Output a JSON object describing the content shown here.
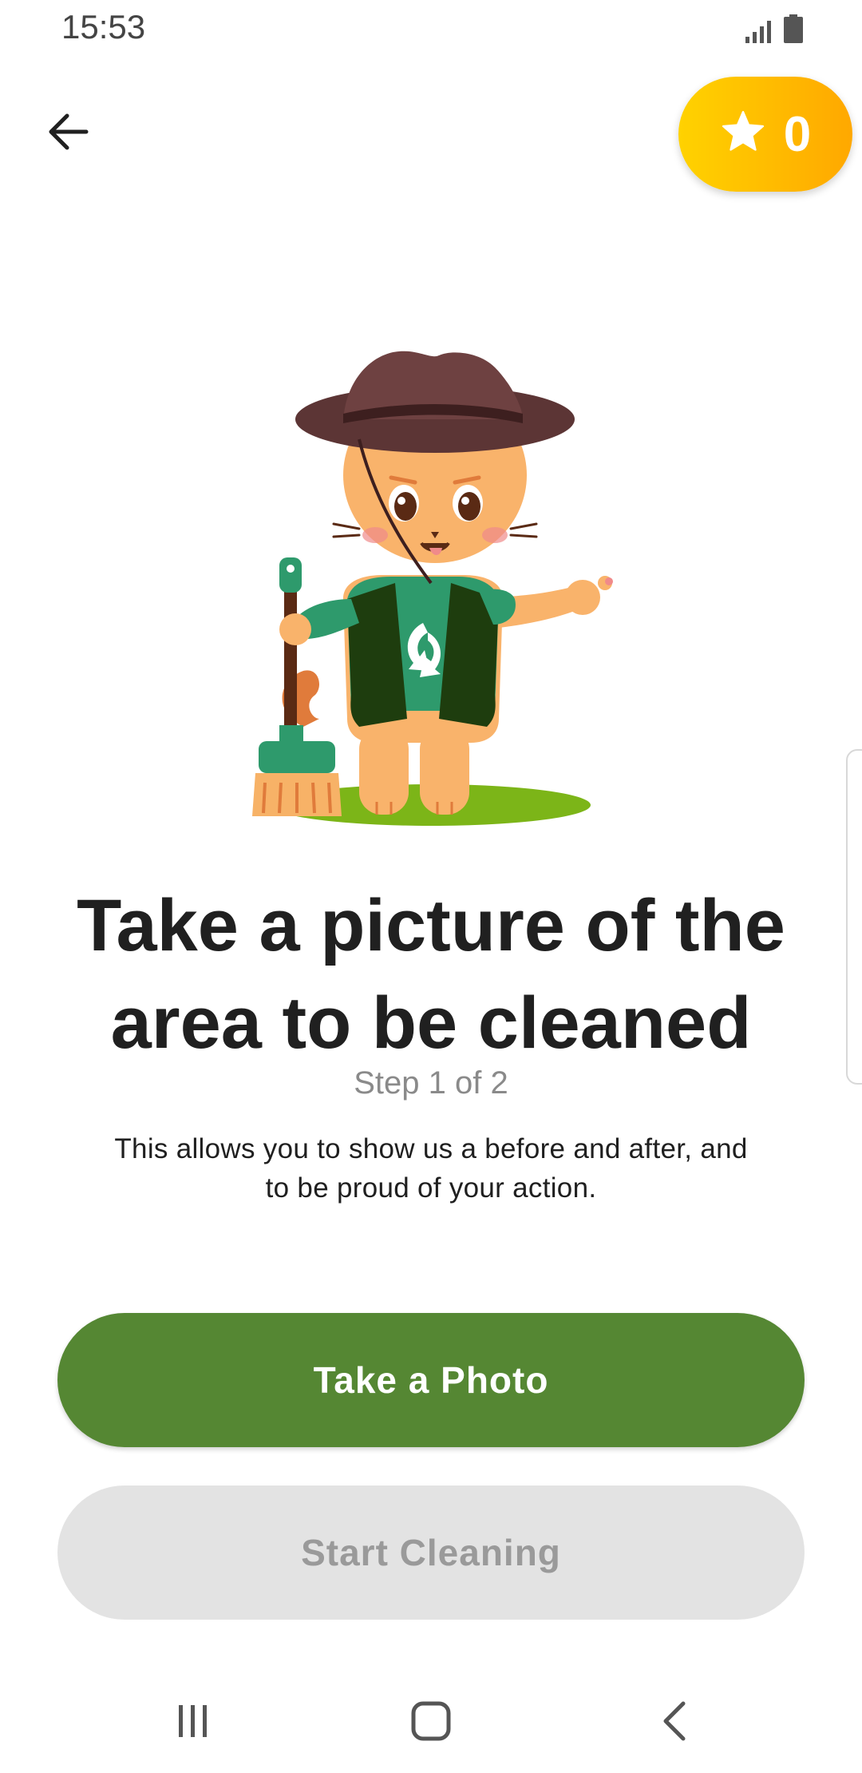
{
  "status_bar": {
    "time": "15:53",
    "icons": [
      "signal-icon",
      "battery-icon"
    ]
  },
  "header": {
    "back_icon": "arrow-left-icon",
    "points": {
      "icon": "star-icon",
      "value": "0"
    }
  },
  "colors": {
    "primary_green": "#558733",
    "badge_gradient_start": "#FFD200",
    "badge_gradient_end": "#FFA800",
    "disabled_bg": "#e3e3e3",
    "disabled_text": "#9a9a9a"
  },
  "content": {
    "illustration": "cat-mascot-with-broom",
    "title_line1": "Take a picture of the",
    "title_line2": "area to be cleaned",
    "step": "Step 1 of 2",
    "description_line1": "This allows you to show us a before and after, and",
    "description_line2": "to be proud of your action."
  },
  "actions": {
    "take_photo_label": "Take a Photo",
    "start_cleaning_label": "Start Cleaning"
  },
  "nav_bar": {
    "recents_icon": "recents-icon",
    "home_icon": "home-icon",
    "back_icon": "nav-back-icon"
  }
}
